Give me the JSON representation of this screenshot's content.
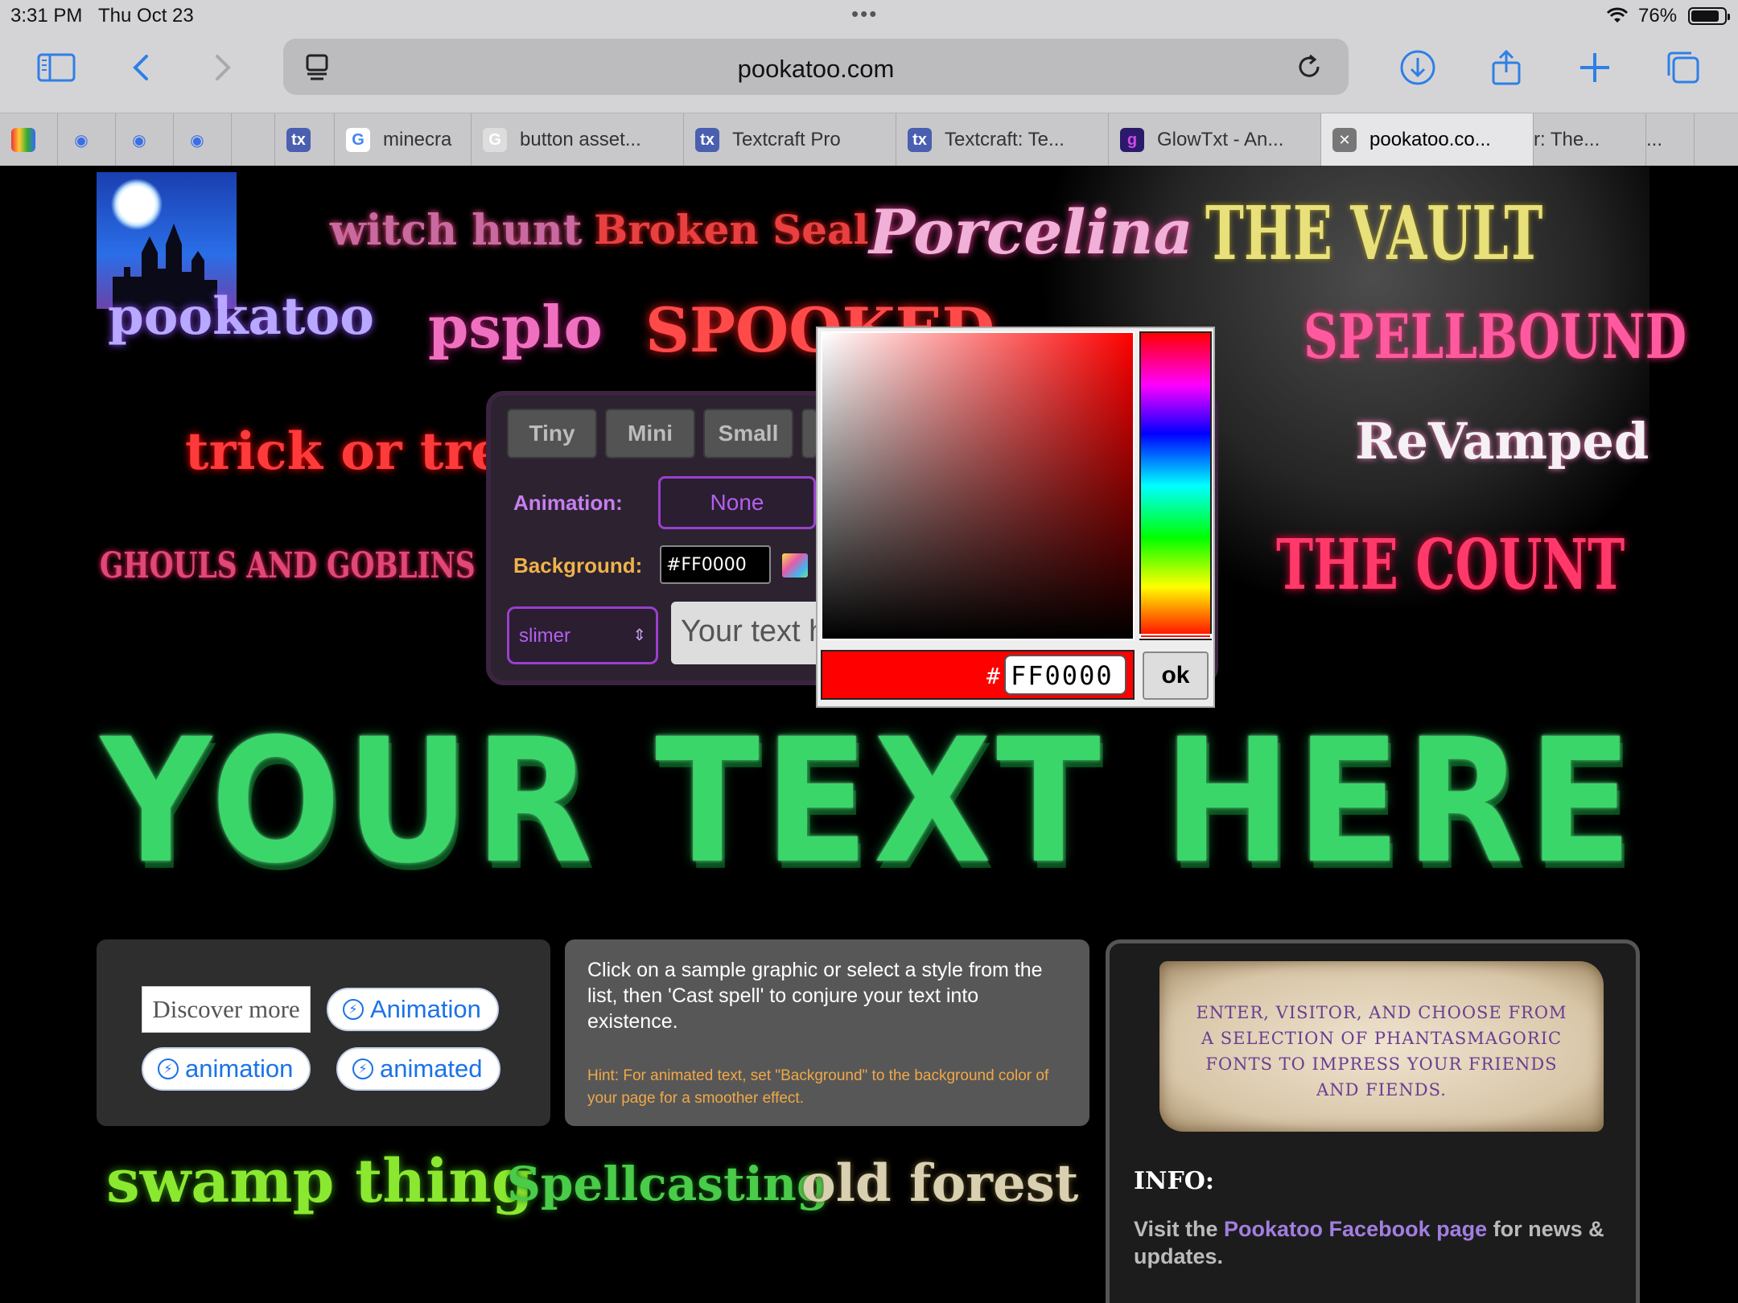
{
  "status_bar": {
    "time": "3:31 PM",
    "date": "Thu Oct 23",
    "battery": "76%",
    "battery_level": 0.76
  },
  "address_bar": {
    "url": "pookatoo.com"
  },
  "tabs": [
    {
      "label": ""
    },
    {
      "label": ""
    },
    {
      "label": ""
    },
    {
      "label": ""
    },
    {
      "label": ""
    },
    {
      "label": "minecra"
    },
    {
      "label": "button asset..."
    },
    {
      "label": "Textcraft Pro"
    },
    {
      "label": "Textcraft: Te..."
    },
    {
      "label": "GlowTxt - An..."
    },
    {
      "label": "pookatoo.co..."
    },
    {
      "label": "r: The..."
    },
    {
      "label": "..."
    }
  ],
  "samples": {
    "witch_hunt": "witch hunt",
    "broken_seal": "Broken Seal",
    "porcelina": "Porcelina",
    "the_vault": "THE VAULT",
    "pookatoo": "pookatoo",
    "psplo": "psplo",
    "spooked": "SPOOKED",
    "spellbound": "SPELLBOUND",
    "revamped": "ReVamped",
    "trick_or_treat": "trick or treat",
    "ghouls": "GHOULS AND GOBLINS",
    "the_count": "THE COUNT",
    "swamp_thing": "swamp thing",
    "spellcasting": "Spellcasting",
    "old_forest": "old forest"
  },
  "controls": {
    "sizes": [
      "Tiny",
      "Mini",
      "Small"
    ],
    "animation_label": "Animation:",
    "animation_value": "None",
    "background_label": "Background:",
    "background_value": "#FF0000",
    "font_value": "slimer",
    "text_placeholder": "Your text h"
  },
  "picker": {
    "hash": "#",
    "hex": "FF0000",
    "ok_label": "ok",
    "color": "#FF0000"
  },
  "preview_text": "YOUR TEXT HERE",
  "ad_box": {
    "discover": "Discover more",
    "pills": [
      "Animation",
      "animation",
      "animated"
    ]
  },
  "help": {
    "text": "Click on a sample graphic or select a style from the list, then 'Cast spell' to conjure your text into existence.",
    "hint": "Hint: For animated text, set \"Background\" to the background color of your page for a smoother effect."
  },
  "info": {
    "scroll_text": "ENTER, VISITOR, AND CHOOSE FROM A SELECTION OF PHANTASMAGORIC FONTS TO IMPRESS YOUR FRIENDS AND FIENDS.",
    "heading": "INFO:",
    "p_prefix": "Visit the ",
    "p_link": "Pookatoo Facebook page",
    "p_suffix": " for news & updates."
  }
}
